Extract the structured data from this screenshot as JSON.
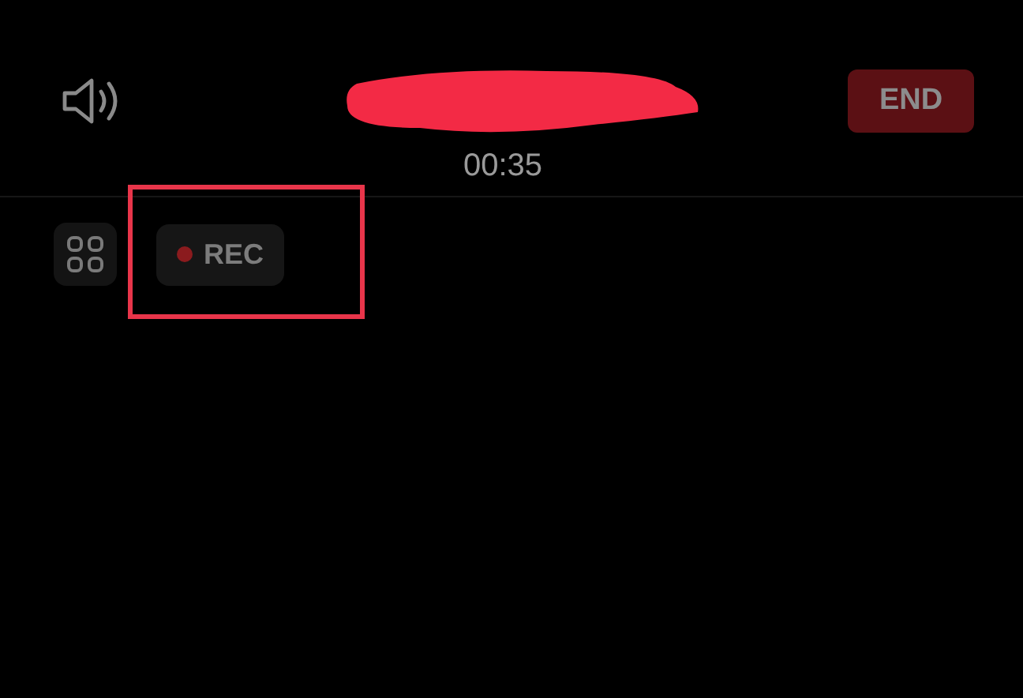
{
  "call": {
    "timer": "00:35",
    "end_button": "END"
  },
  "toolbar": {
    "recorder": {
      "label": "REC",
      "recording": true
    }
  },
  "overlays": {
    "redaction": true,
    "highlight_frame": true
  }
}
